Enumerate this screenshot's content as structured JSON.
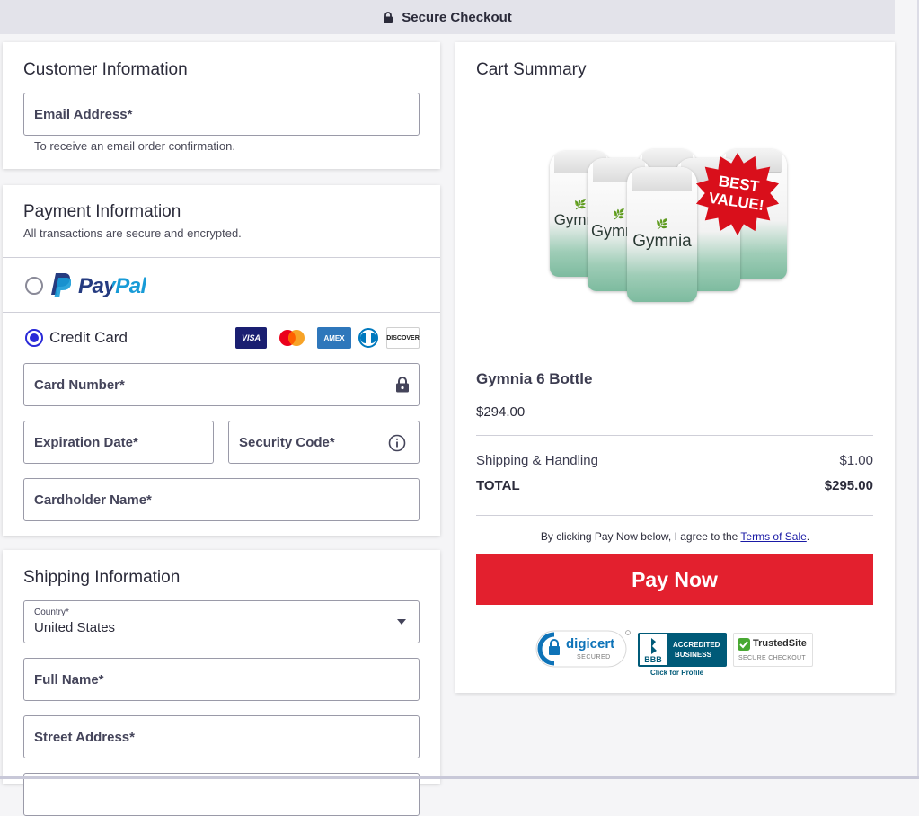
{
  "header": {
    "title": "Secure Checkout",
    "icon": "lock-icon"
  },
  "customer": {
    "title": "Customer Information",
    "email_label": "Email Address*",
    "email_hint": "To receive an email order confirmation."
  },
  "payment": {
    "title": "Payment Information",
    "subtitle": "All transactions are secure and encrypted.",
    "paypal_label": "PayPal",
    "credit_label": "Credit Card",
    "selected": "credit_card",
    "card_brands": [
      "VISA",
      "Mastercard",
      "AMEX",
      "Diners Club",
      "DISCOVER"
    ],
    "card_number_label": "Card Number*",
    "expiration_label": "Expiration Date*",
    "security_label": "Security Code*",
    "cardholder_label": "Cardholder Name*"
  },
  "shipping": {
    "title": "Shipping Information",
    "country_label": "Country*",
    "country_value": "United States",
    "full_name_label": "Full Name*",
    "street_label": "Street Address*"
  },
  "cart": {
    "title": "Cart Summary",
    "product_brand": "Gymnia",
    "badge_line1": "BEST",
    "badge_line2": "VALUE!",
    "product_name": "Gymnia 6 Bottle",
    "product_price": "$294.00",
    "shipping_label": "Shipping & Handling",
    "shipping_value": "$1.00",
    "total_label": "TOTAL",
    "total_value": "$295.00",
    "agree_prefix": "By clicking Pay Now below, I agree to the ",
    "terms_link": "Terms of Sale",
    "agree_suffix": ".",
    "pay_button": "Pay Now"
  },
  "trust": {
    "digicert": "digicert",
    "digicert_sub": "SECURED",
    "bbb_line1": "ACCREDITED",
    "bbb_line2": "BUSINESS",
    "bbb_logo": "BBB",
    "bbb_link": "Click for Profile",
    "trustedsite": "TrustedSite",
    "trustedsite_sub": "SECURE CHECKOUT"
  },
  "colors": {
    "accent": "#e3202e",
    "radio": "#2a2ad8",
    "paypal_dark": "#253b80",
    "paypal_light": "#179bd7"
  }
}
